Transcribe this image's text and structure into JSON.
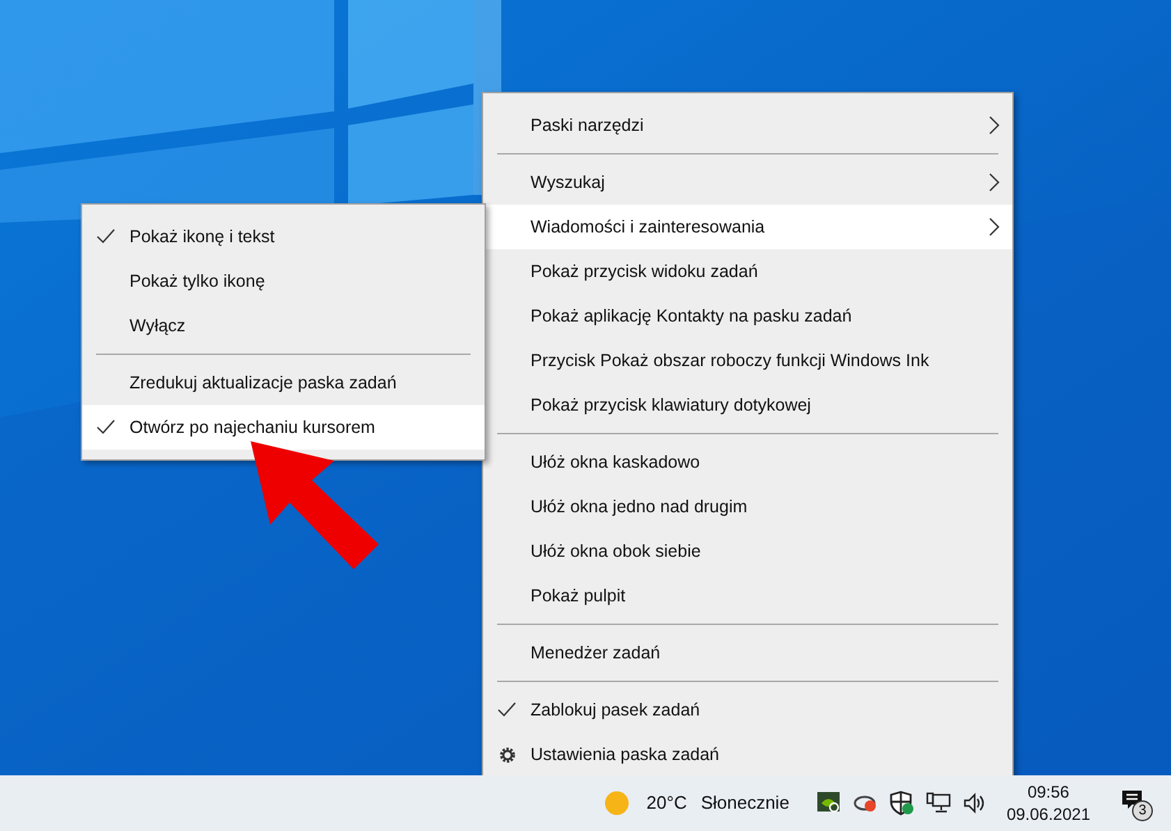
{
  "context_menu": {
    "items": [
      {
        "kind": "item",
        "label": "Paski narzędzi",
        "submenu": true,
        "checked": false,
        "selected": false
      },
      {
        "kind": "separator"
      },
      {
        "kind": "item",
        "label": "Wyszukaj",
        "submenu": true,
        "checked": false,
        "selected": false
      },
      {
        "kind": "item",
        "label": "Wiadomości i zainteresowania",
        "submenu": true,
        "checked": false,
        "selected": true
      },
      {
        "kind": "item",
        "label": "Pokaż przycisk widoku zadań",
        "submenu": false,
        "checked": false,
        "selected": false
      },
      {
        "kind": "item",
        "label": "Pokaż aplikację Kontakty na pasku zadań",
        "submenu": false,
        "checked": false,
        "selected": false
      },
      {
        "kind": "item",
        "label": "Przycisk Pokaż obszar roboczy funkcji Windows Ink",
        "submenu": false,
        "checked": false,
        "selected": false
      },
      {
        "kind": "item",
        "label": "Pokaż przycisk klawiatury dotykowej",
        "submenu": false,
        "checked": false,
        "selected": false
      },
      {
        "kind": "separator"
      },
      {
        "kind": "item",
        "label": "Ułóż okna kaskadowo",
        "submenu": false,
        "checked": false,
        "selected": false
      },
      {
        "kind": "item",
        "label": "Ułóż okna jedno nad drugim",
        "submenu": false,
        "checked": false,
        "selected": false
      },
      {
        "kind": "item",
        "label": "Ułóż okna obok siebie",
        "submenu": false,
        "checked": false,
        "selected": false
      },
      {
        "kind": "item",
        "label": "Pokaż pulpit",
        "submenu": false,
        "checked": false,
        "selected": false
      },
      {
        "kind": "separator"
      },
      {
        "kind": "item",
        "label": "Menedżer zadań",
        "submenu": false,
        "checked": false,
        "selected": false
      },
      {
        "kind": "separator"
      },
      {
        "kind": "item",
        "label": "Zablokuj pasek zadań",
        "submenu": false,
        "checked": true,
        "selected": false
      },
      {
        "kind": "gear-item",
        "label": "Ustawienia paska zadań",
        "submenu": false,
        "checked": false,
        "selected": false
      }
    ]
  },
  "submenu": {
    "items": [
      {
        "kind": "item",
        "label": "Pokaż ikonę i tekst",
        "checked": true,
        "selected": false
      },
      {
        "kind": "item",
        "label": "Pokaż tylko ikonę",
        "checked": false,
        "selected": false
      },
      {
        "kind": "item",
        "label": "Wyłącz",
        "checked": false,
        "selected": false
      },
      {
        "kind": "separator"
      },
      {
        "kind": "item",
        "label": "Zredukuj aktualizacje paska zadań",
        "checked": false,
        "selected": false
      },
      {
        "kind": "item",
        "label": "Otwórz po najechaniu kursorem",
        "checked": true,
        "selected": true
      }
    ]
  },
  "taskbar": {
    "temperature": "20°C",
    "weather": "Słonecznie",
    "time": "09:56",
    "date": "09.06.2021",
    "notification_count": "3"
  }
}
